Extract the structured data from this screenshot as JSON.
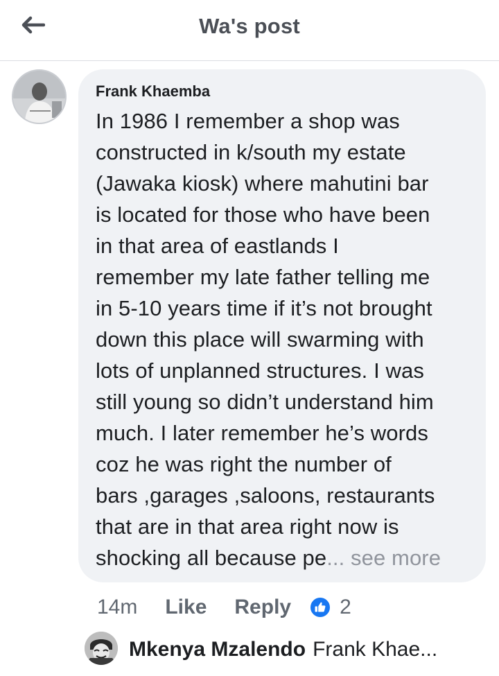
{
  "header": {
    "title": "Wa's post"
  },
  "comment": {
    "author": "Frank Khaemba",
    "text_lines": [
      "In 1986 I remember a shop was",
      "constructed in k/south my estate",
      "(Jawaka kiosk) where mahutini bar",
      "is located for those who have been",
      "in that area of eastlands I",
      "remember my late father telling me",
      "in 5-10 years time if it’s not brought",
      "down this place will swarming with",
      "lots of unplanned structures. I was",
      "still young so didn’t understand him",
      "much. I later remember he’s words",
      "coz he was right the number of",
      "bars ,garages ,saloons, restaurants",
      "that are in that area right now is"
    ],
    "last_line": "shocking all because pe",
    "see_more": "... see more",
    "time": "14m",
    "like_label": "Like",
    "reply_label": "Reply",
    "reaction_icon": "like-thumb-icon",
    "reaction_count": "2"
  },
  "reply_preview": {
    "author": "Mkenya Mzalendo",
    "text": "Frank Khae..."
  },
  "colors": {
    "bubble": "#f0f2f5",
    "like_blue": "#1877f2",
    "muted_text": "#606770"
  }
}
